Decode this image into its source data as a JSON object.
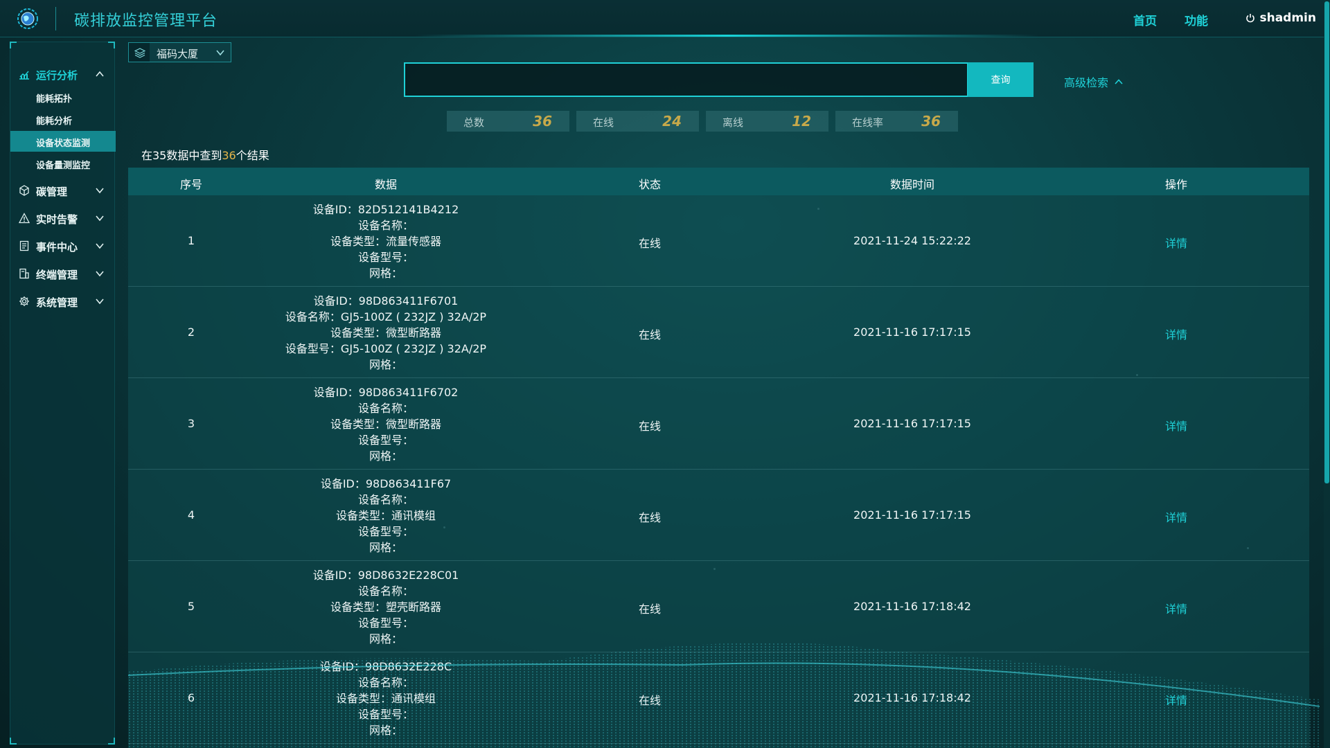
{
  "header": {
    "title": "碳排放监控管理平台",
    "nav": [
      "首页",
      "功能"
    ],
    "user": "shadmin"
  },
  "sidebar": {
    "groups": [
      {
        "label": "运行分析",
        "icon": "chart-icon",
        "expanded": true,
        "items": [
          "能耗拓扑",
          "能耗分析",
          "设备状态监测",
          "设备量测监控"
        ],
        "active": "设备状态监测"
      },
      {
        "label": "碳管理",
        "icon": "cube-icon",
        "expanded": false
      },
      {
        "label": "实时告警",
        "icon": "warning-icon",
        "expanded": false
      },
      {
        "label": "事件中心",
        "icon": "document-icon",
        "expanded": false
      },
      {
        "label": "终端管理",
        "icon": "terminal-icon",
        "expanded": false
      },
      {
        "label": "系统管理",
        "icon": "gear-icon",
        "expanded": false
      }
    ]
  },
  "selector": {
    "value": "福码大厦"
  },
  "search": {
    "value": "",
    "button": "查询",
    "advanced": "高级检索"
  },
  "stats": [
    {
      "label": "总数",
      "value": "36"
    },
    {
      "label": "在线",
      "value": "24"
    },
    {
      "label": "离线",
      "value": "12"
    },
    {
      "label": "在线率",
      "value": "36"
    }
  ],
  "summary": {
    "prefix": "在35数据中查到",
    "count": "36",
    "suffix": "个结果"
  },
  "table": {
    "columns": [
      "序号",
      "数据",
      "状态",
      "数据时间",
      "操作"
    ],
    "rows": [
      {
        "index": "1",
        "lines": [
          "设备ID：82D512141B4212",
          "设备名称：",
          "设备类型：流量传感器",
          "设备型号：",
          "网格："
        ],
        "status": "在线",
        "time": "2021-11-24 15:22:22",
        "action": "详情"
      },
      {
        "index": "2",
        "lines": [
          "设备ID：98D863411F6701",
          "设备名称：GJ5-100Z ( 232JZ ) 32A/2P",
          "设备类型：微型断路器",
          "设备型号：GJ5-100Z ( 232JZ ) 32A/2P",
          "网格："
        ],
        "status": "在线",
        "time": "2021-11-16 17:17:15",
        "action": "详情"
      },
      {
        "index": "3",
        "lines": [
          "设备ID：98D863411F6702",
          "设备名称：",
          "设备类型：微型断路器",
          "设备型号：",
          "网格："
        ],
        "status": "在线",
        "time": "2021-11-16 17:17:15",
        "action": "详情"
      },
      {
        "index": "4",
        "lines": [
          "设备ID：98D863411F67",
          "设备名称：",
          "设备类型：通讯模组",
          "设备型号：",
          "网格："
        ],
        "status": "在线",
        "time": "2021-11-16 17:17:15",
        "action": "详情"
      },
      {
        "index": "5",
        "lines": [
          "设备ID：98D8632E228C01",
          "设备名称：",
          "设备类型：塑壳断路器",
          "设备型号：",
          "网格："
        ],
        "status": "在线",
        "time": "2021-11-16 17:18:42",
        "action": "详情"
      },
      {
        "index": "6",
        "lines": [
          "设备ID：98D8632E228C",
          "设备名称：",
          "设备类型：通讯模组",
          "设备型号：",
          "网格："
        ],
        "status": "在线",
        "time": "2021-11-16 17:18:42",
        "action": "详情"
      }
    ]
  },
  "colors": {
    "accent": "#1fd1d7",
    "active_menu": "#14888f",
    "stat_value": "#c7a94a",
    "highlight": "#e5b54a"
  }
}
